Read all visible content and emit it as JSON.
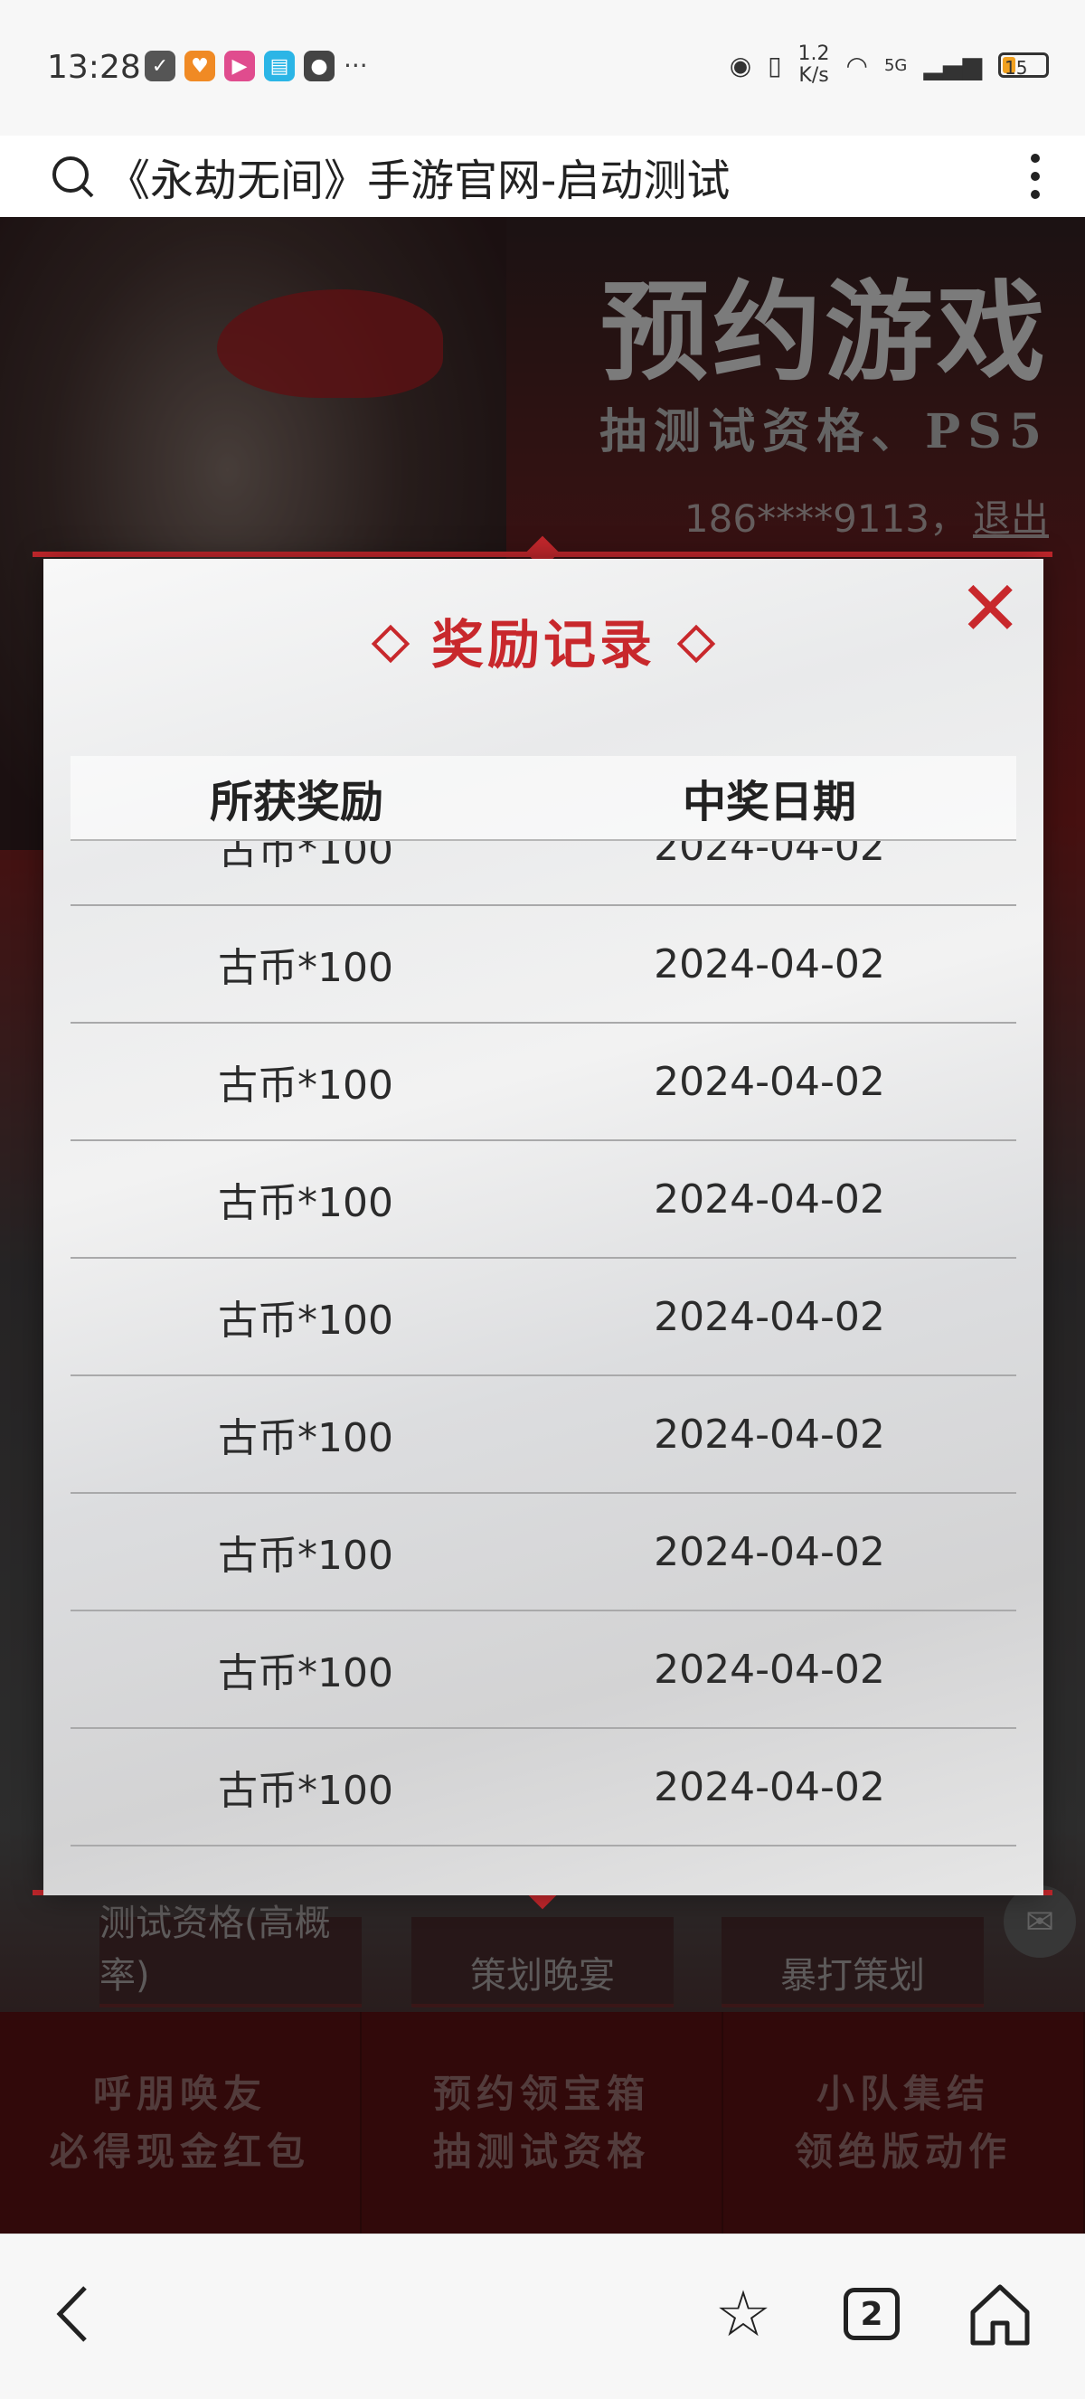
{
  "status_bar": {
    "time": "13:28",
    "net_speed_value": "1.2",
    "net_speed_unit": "K/s",
    "network": "5G",
    "battery": "15"
  },
  "browser": {
    "page_title": "《永劫无间》手游官网-启动测试",
    "tab_count": "2"
  },
  "page": {
    "banner_title": "预约游戏",
    "banner_subtitle": "抽测试资格、PS5",
    "user_phone": "186****9113，",
    "logout_label": "退出",
    "buttons": [
      "测试资格(高概率)",
      "策划晚宴",
      "暴打策划"
    ],
    "promos": [
      {
        "line1": "呼朋唤友",
        "line2": "必得现金红包"
      },
      {
        "line1": "预约领宝箱",
        "line2": "抽测试资格"
      },
      {
        "line1": "小队集结",
        "line2": "领绝版动作"
      }
    ]
  },
  "modal": {
    "title": "奖励记录",
    "close_icon": "close-x-icon",
    "columns": [
      "所获奖励",
      "中奖日期"
    ],
    "rows": [
      {
        "reward": "古币*100",
        "date": "2024-04-02"
      },
      {
        "reward": "古币*100",
        "date": "2024-04-02"
      },
      {
        "reward": "古币*100",
        "date": "2024-04-02"
      },
      {
        "reward": "古币*100",
        "date": "2024-04-02"
      },
      {
        "reward": "古币*100",
        "date": "2024-04-02"
      },
      {
        "reward": "古币*100",
        "date": "2024-04-02"
      },
      {
        "reward": "古币*100",
        "date": "2024-04-02"
      },
      {
        "reward": "古币*100",
        "date": "2024-04-02"
      },
      {
        "reward": "古币*100",
        "date": "2024-04-02"
      }
    ]
  },
  "colors": {
    "accent_red": "#c8282c",
    "battery_low": "#f0a020"
  }
}
